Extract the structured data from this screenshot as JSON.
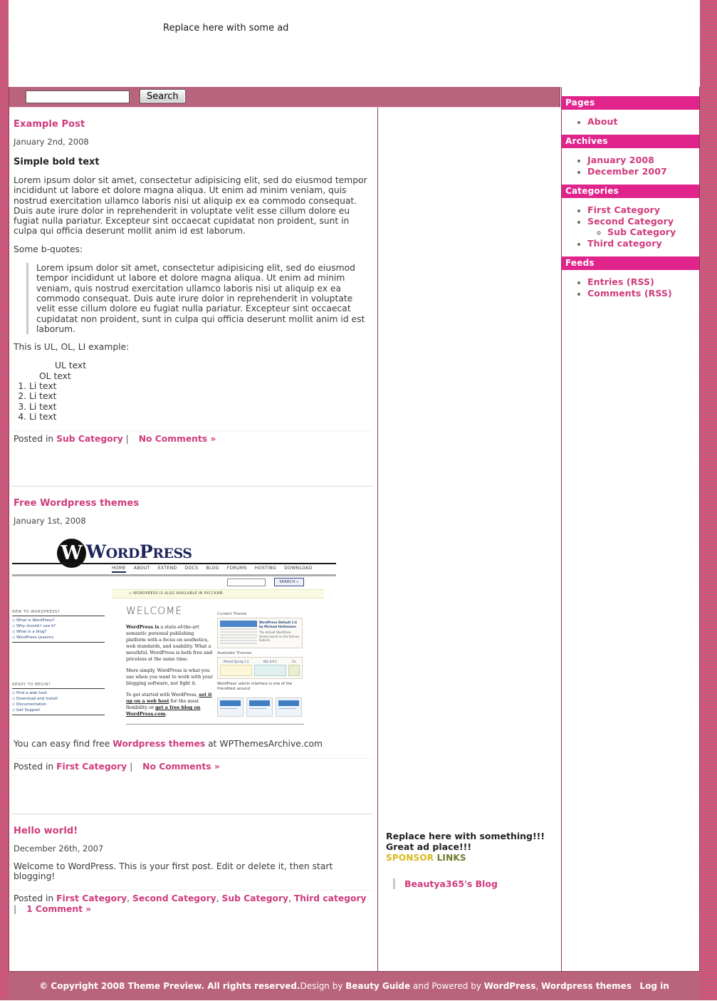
{
  "banner": {
    "ad_text": "Replace here with some ad"
  },
  "search": {
    "value": "",
    "placeholder": "",
    "button_label": "Search"
  },
  "posts": [
    {
      "title": "Example Post",
      "date": "January 2nd, 2008",
      "heading": "Simple bold text",
      "paragraph": "Lorem ipsum dolor sit amet, consectetur adipisicing elit, sed do eiusmod tempor incididunt ut labore et dolore magna aliqua. Ut enim ad minim veniam, quis nostrud exercitation ullamco laboris nisi ut aliquip ex ea commodo consequat. Duis aute irure dolor in reprehenderit in voluptate velit esse cillum dolore eu fugiat nulla pariatur. Excepteur sint occaecat cupidatat non proident, sunt in culpa qui officia deserunt mollit anim id est laborum.",
      "quote_intro": "Some b-quotes:",
      "blockquote": "Lorem ipsum dolor sit amet, consectetur adipisicing elit, sed do eiusmod tempor incididunt ut labore et dolore magna aliqua. Ut enim ad minim veniam, quis nostrud exercitation ullamco laboris nisi ut aliquip ex ea commodo consequat. Duis aute irure dolor in reprehenderit in voluptate velit esse cillum dolore eu fugiat nulla pariatur. Excepteur sint occaecat cupidatat non proident, sunt in culpa qui officia deserunt mollit anim id est laborum.",
      "list_intro": "This is UL, OL, LI example:",
      "ul_label": "UL text",
      "ol_label": "OL text",
      "ol_items": [
        "Li text",
        "Li text",
        "Li text",
        "Li text"
      ],
      "meta_prefix": "Posted in ",
      "categories": [
        "Sub Category"
      ],
      "separator": "|",
      "comments_label": "No Comments »"
    },
    {
      "title": "Free Wordpress themes",
      "date": "January 1st, 2008",
      "caption_before": "You can easy find free ",
      "caption_link": "Wordpress themes",
      "caption_after": " at WPThemesArchive.com",
      "meta_prefix": "Posted in ",
      "categories": [
        "First Category"
      ],
      "separator": "|",
      "comments_label": "No Comments »"
    },
    {
      "title": "Hello world!",
      "date": "December 26th, 2007",
      "paragraph": "Welcome to WordPress. This is your first post. Edit or delete it, then start blogging!",
      "meta_prefix": "Posted in ",
      "categories": [
        "First Category",
        "Second Category",
        "Sub Category",
        "Third category"
      ],
      "separator": "|",
      "comments_label": "1 Comment »"
    }
  ],
  "wp_screenshot": {
    "logo_letter": "W",
    "wordmark_big": "W",
    "wordmark_rest": "ORD",
    "wordmark_big2": "P",
    "wordmark_rest2": "RESS",
    "nav": [
      "HOME",
      "ABOUT",
      "EXTEND",
      "DOCS",
      "BLOG",
      "FORUMS",
      "HOSTING",
      "DOWNLOAD"
    ],
    "search_button": "SEARCH »",
    "notice": "◇ WORDPRESS IS ALSO AVAILABLE IN РУССКИЙ.",
    "welcome": "WELCOME",
    "left_heading_1": "NEW TO WORDPRESS?",
    "left_items_1": [
      "◇ What is WordPress?",
      "◇ Why should I use it?",
      "◇ What is a blog?",
      "◇ WordPress Lessons"
    ],
    "left_heading_2": "READY TO BEGIN?",
    "left_items_2": [
      "◇ Find a web host",
      "◇ Download and Install",
      "◇ Documentation",
      "◇ Get Support"
    ],
    "para1_bold": "WordPress is",
    "para1_rest": " a state-of-the-art semantic personal publishing platform with a focus on aesthetics, web standards, and usability. What a mouthful. WordPress is both free and priceless at the same time.",
    "para2": "More simply, WordPress is what you use when you want to work with your blogging software, not fight it.",
    "para3_a": "To get started with WordPress, ",
    "para3_link1": "set it up on a web host",
    "para3_b": " for the most flexibility or ",
    "para3_link2": "get a free blog on WordPress.com",
    "para3_c": ".",
    "panel_label_1": "Current Theme",
    "panel_theme_name": "WordPress Default 1.6 by Michael Heilemann",
    "panel_theme_desc": "The default WordPress theme based on the famous Kubrick.",
    "panel_label_2": "Available Themes",
    "panel_theme_a": "Almost Spring 1.1",
    "panel_theme_b": "Blix 0.9.1",
    "panel_theme_c": "Co",
    "caption_right": "WordPress' admin interface is one of the friendliest around."
  },
  "mid_ad": {
    "title": "Replace here with something!!! Great ad place!!!",
    "sponsor_word": "SPONSOR",
    "links_word": "LINKS",
    "link_label": "Beautya365's Blog"
  },
  "sidebar": {
    "sections": [
      {
        "title": "Pages",
        "items": [
          {
            "label": "About"
          }
        ]
      },
      {
        "title": "Archives",
        "items": [
          {
            "label": "January 2008"
          },
          {
            "label": "December 2007"
          }
        ]
      },
      {
        "title": "Categories",
        "items": [
          {
            "label": "First Category"
          },
          {
            "label": "Second Category",
            "children": [
              {
                "label": "Sub Category"
              }
            ]
          },
          {
            "label": "Third category"
          }
        ]
      },
      {
        "title": "Feeds",
        "items": [
          {
            "label": "Entries (RSS)"
          },
          {
            "label": "Comments (RSS)"
          }
        ]
      }
    ]
  },
  "footer": {
    "copyright": "© Copyright 2008 Theme Preview. All rights reserved.",
    "design_by": "Design by ",
    "designer": "Beauty Guide",
    "powered_by": " and Powered by ",
    "wordpress": "WordPress",
    "comma": ", ",
    "themes": "Wordpress themes",
    "login": "Log in"
  },
  "colors": {
    "accent_pink": "#cf3b7c",
    "header_magenta": "#e0248c",
    "bar_mauve": "#b9637d",
    "border_maroon": "#8d3a5a",
    "sponsor_gold": "#d9b91a",
    "links_olive": "#6d7a2a"
  }
}
